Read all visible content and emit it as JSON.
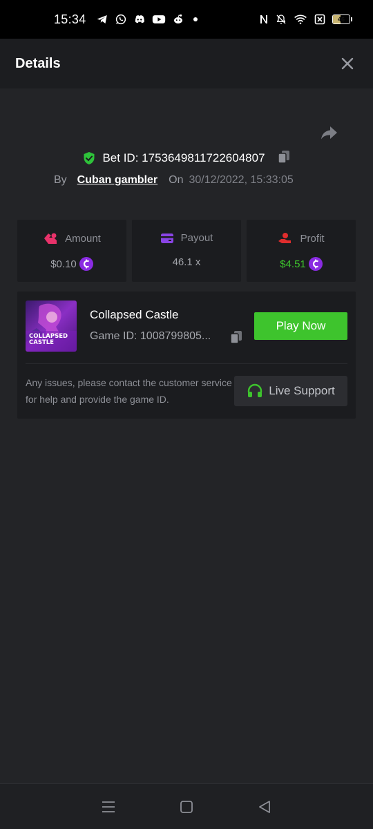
{
  "status_bar": {
    "time": "15:34",
    "battery": "46",
    "app_icons": [
      "telegram-icon",
      "whatsapp-icon",
      "discord-icon",
      "youtube-icon",
      "reddit-icon",
      "dot-icon"
    ],
    "system_icons": [
      "nfc-icon",
      "bell-off-icon",
      "wifi-icon",
      "sim-x-icon",
      "battery-icon"
    ]
  },
  "header": {
    "title": "Details"
  },
  "bet": {
    "id_label": "Bet ID: 1753649811722604807",
    "by_label": "By",
    "user": "Cuban gambler",
    "on_label": "On",
    "date": "30/12/2022, 15:33:05"
  },
  "stats": {
    "amount": {
      "label": "Amount",
      "value": "$0.10"
    },
    "payout": {
      "label": "Payout",
      "value": "46.1 x"
    },
    "profit": {
      "label": "Profit",
      "value": "$4.51"
    }
  },
  "game": {
    "name": "Collapsed Castle",
    "game_id": "Game ID: 1008799805...",
    "thumb_text_1": "COLLAPSED",
    "thumb_text_2": "CASTLE",
    "play_label": "Play Now",
    "help_text": "Any issues, please contact the customer service for help and provide the game ID.",
    "support_label": "Live Support"
  },
  "colors": {
    "accent_green": "#3ec42d",
    "coin_purple": "#8a2be2",
    "background": "#232427",
    "card": "#1b1c1f"
  }
}
